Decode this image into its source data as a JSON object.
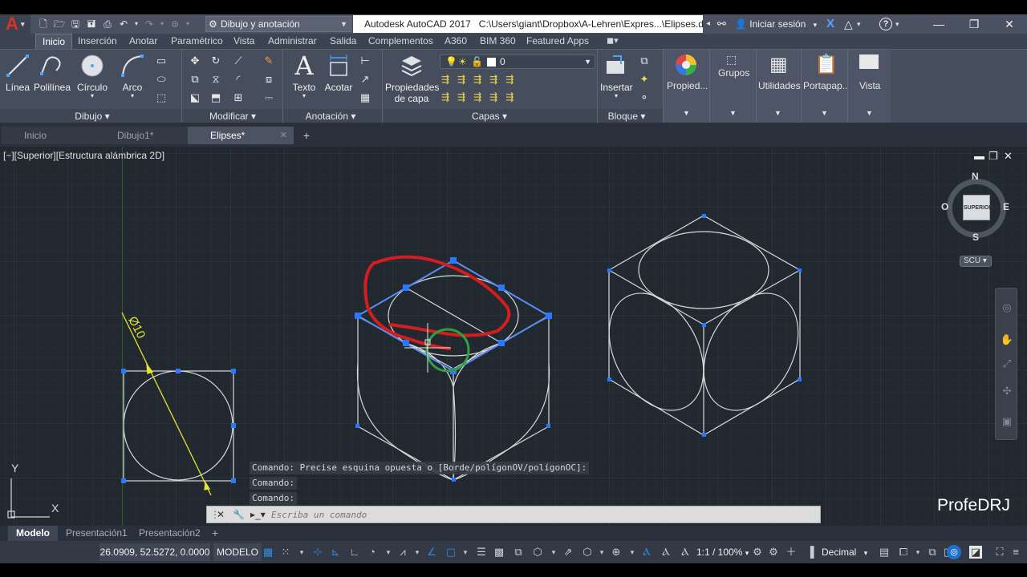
{
  "title_bar": {
    "app_title": "Autodesk AutoCAD 2017",
    "file_path": "C:\\Users\\giant\\Dropbox\\A-Lehren\\Expres...\\Elipses.dwg",
    "workspace": "Dibujo y anotación",
    "signin": "Iniciar sesión",
    "minimize": "—",
    "restore": "❐",
    "close": "✕"
  },
  "ribbon_tabs": [
    "Inicio",
    "Inserción",
    "Anotar",
    "Paramétrico",
    "Vista",
    "Administrar",
    "Salida",
    "Complementos",
    "A360",
    "BIM 360",
    "Featured Apps"
  ],
  "ribbon": {
    "dibujo": {
      "linea": "Línea",
      "polilinea": "Polilínea",
      "circulo": "Círculo",
      "arco": "Arco",
      "panel": "Dibujo"
    },
    "modificar": {
      "panel": "Modificar"
    },
    "anotacion": {
      "texto": "Texto",
      "acotar": "Acotar",
      "panel": "Anotación"
    },
    "capas": {
      "propiedades_1": "Propiedades",
      "propiedades_2": "de capa",
      "current_layer": "0",
      "panel": "Capas"
    },
    "bloque": {
      "insertar": "Insertar",
      "panel": "Bloque"
    },
    "right": {
      "propiedades": "Propied...",
      "grupos": "Grupos",
      "utilidades": "Utilidades",
      "portapapeles": "Portapap...",
      "vista": "Vista"
    }
  },
  "doc_tabs": [
    {
      "label": "Inicio"
    },
    {
      "label": "Dibujo1*"
    },
    {
      "label": "Elipses*"
    }
  ],
  "viewport": {
    "label": "[−][Superior][Estructura alámbrica 2D]",
    "viewcube": {
      "north": "N",
      "south": "S",
      "east": "E",
      "west": "O",
      "face": "SUPERIOR",
      "ucs": "SCU"
    },
    "dimension_text": "Ø10",
    "axis_y": "Y",
    "axis_x": "X"
  },
  "command": {
    "history": [
      "Comando: Precise esquina opuesta o [Borde/polígonOV/polígonOC]:",
      "Comando:",
      "Comando:"
    ],
    "placeholder": "Escriba un comando"
  },
  "watermark": "ProfeDRJ",
  "layout_tabs": [
    "Modelo",
    "Presentación1",
    "Presentación2"
  ],
  "status": {
    "coords": "26.0909, 52.5272, 0.0000",
    "model": "MODELO",
    "scale": "1:1 / 100%",
    "units": "Decimal"
  },
  "colors": {
    "canvas_bg": "#212830",
    "selection_blue": "#5b8def",
    "grip_blue": "#2979ff",
    "annotation_red": "#d21e1e",
    "annotation_green": "#2ea043",
    "dimension_yellow": "#e6e62e"
  }
}
